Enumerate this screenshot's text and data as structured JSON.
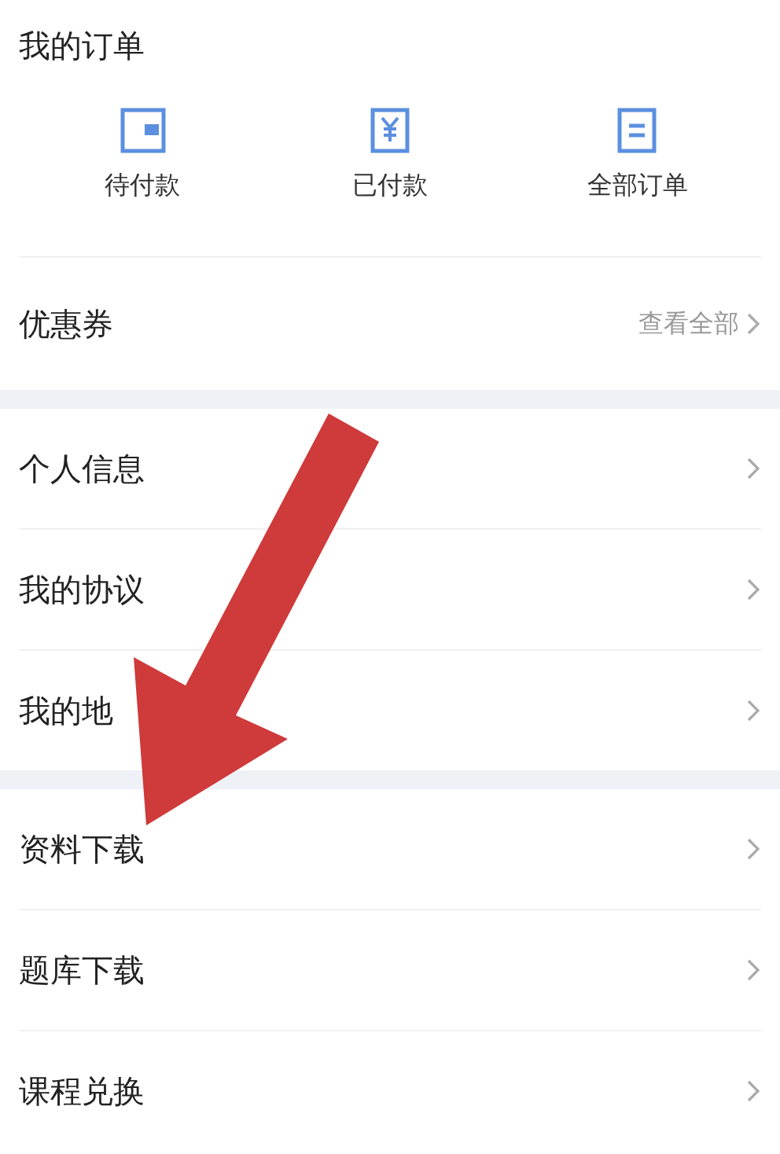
{
  "orders": {
    "title": "我的订单",
    "items": [
      {
        "kind": "wallet",
        "label": "待付款"
      },
      {
        "kind": "yen",
        "label": "已付款"
      },
      {
        "kind": "list",
        "label": "全部订单"
      }
    ]
  },
  "coupon": {
    "label": "优惠券",
    "link": "查看全部"
  },
  "groups": [
    {
      "items": [
        {
          "label": "个人信息"
        },
        {
          "label": "我的协议"
        },
        {
          "label": "我的地"
        }
      ]
    },
    {
      "items": [
        {
          "label": "资料下载"
        },
        {
          "label": "题库下载"
        },
        {
          "label": "课程兑换"
        }
      ]
    }
  ],
  "annotation": {
    "kind": "arrow"
  }
}
